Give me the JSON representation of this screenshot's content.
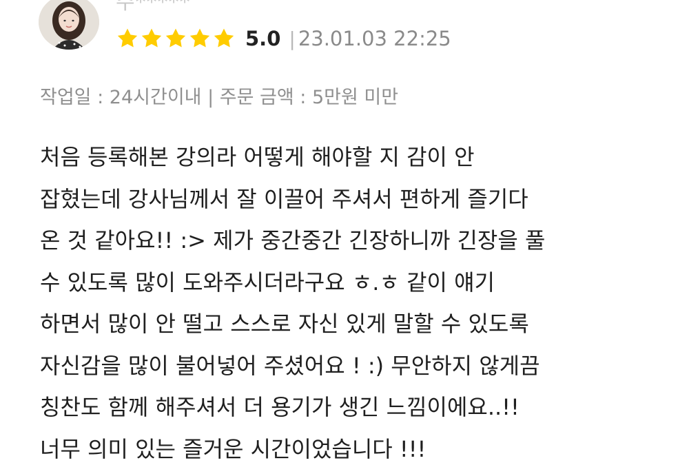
{
  "reviewer": {
    "name": "주*****",
    "avatar_icon": "user-avatar-photo"
  },
  "rating": {
    "stars": 5,
    "max_stars": 5,
    "star_color": "#FFCC00",
    "score": "5.0",
    "divider": "|",
    "date": "23.01.03 22:25"
  },
  "meta": {
    "text": "작업일 : 24시간이내 | 주문 금액 : 5만원 미만"
  },
  "review": {
    "lines": [
      "처음 등록해본 강의라 어떻게 해야할 지 감이 안",
      "잡혔는데 강사님께서 잘 이끌어 주셔서 편하게 즐기다",
      "온 것 같아요!! :> 제가 중간중간 긴장하니까 긴장을 풀",
      "수 있도록 많이 도와주시더라구요 ㅎ.ㅎ 같이 얘기",
      "하면서 많이 안 떨고 스스로 자신 있게 말할 수 있도록",
      "자신감을 많이 불어넣어 주셨어요 ! :) 무안하지 않게끔",
      "칭찬도 함께 해주셔서 더 용기가 생긴 느낌이에요..!!",
      "너무 의미 있는 즐거운 시간이었습니다 !!!"
    ]
  }
}
